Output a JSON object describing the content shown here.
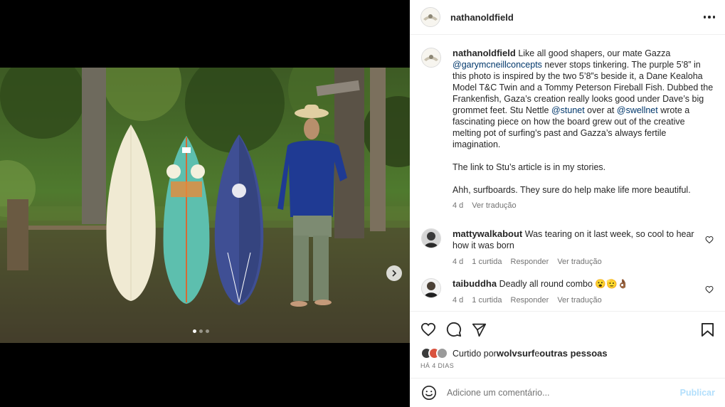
{
  "post": {
    "username": "nathanoldfield"
  },
  "caption": {
    "username": "nathanoldfield",
    "text_1": "Like all good shapers, our mate Gazza ",
    "mention_1": "@garymcneillconcepts",
    "text_2": " never stops tinkering. The purple 5’8” in this photo is inspired by the two 5’8”s beside it, a Dane Kealoha Model T&C Twin and a Tommy Peterson Fireball Fish. Dubbed the Frankenfish, Gaza’s creation really looks good under Dave’s big grommet feet. Stu Nettle ",
    "mention_2": "@stunet",
    "text_3": " over at ",
    "mention_3": "@swellnet",
    "text_4": " wrote a fascinating piece on how the board grew out of the creative melting pot of surfing’s past and Gazza’s always fertile imagination.",
    "para_2": "The link to Stu’s article is in my stories.",
    "para_3": "Ahh, surfboards. They sure do help make life more beautiful.",
    "age": "4 d",
    "translate": "Ver tradução"
  },
  "comments": [
    {
      "username": "mattywalkabout",
      "text": "Was tearing on it last week, so cool to hear how it was born",
      "age": "4 d",
      "likes": "1 curtida",
      "reply": "Responder",
      "translate": "Ver tradução"
    },
    {
      "username": "taibuddha",
      "text": "Deadly all round combo 😮🫡👌🏾",
      "age": "4 d",
      "likes": "1 curtida",
      "reply": "Responder",
      "translate": "Ver tradução"
    }
  ],
  "likes": {
    "prefix": "Curtido por ",
    "user": "wolvsurf",
    "suffix": " e ",
    "others": "outras pessoas"
  },
  "time_ago": "HÁ 4 DIAS",
  "add_comment": {
    "placeholder": "Adicione um comentário...",
    "publish": "Publicar"
  },
  "carousel": {
    "total": 3,
    "active": 1
  },
  "icons": [
    "more-icon",
    "heart-icon",
    "comment-icon",
    "share-icon",
    "bookmark-icon",
    "emoji-icon",
    "chevron-right-icon"
  ],
  "colors": {
    "link": "#00376b",
    "muted": "#737373",
    "publish_disabled": "#b2dffc"
  }
}
